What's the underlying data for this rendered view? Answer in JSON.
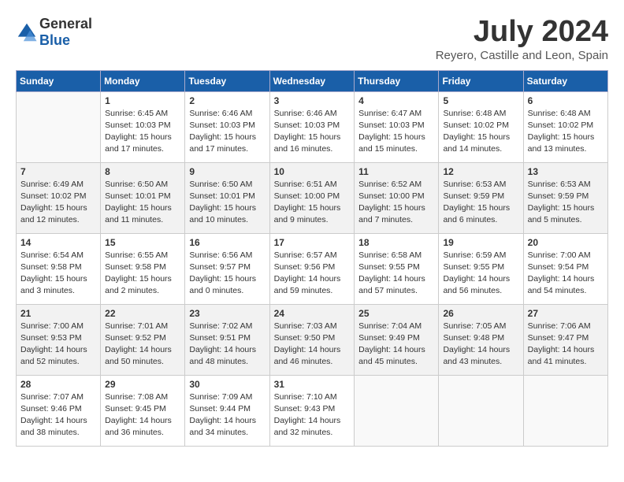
{
  "logo": {
    "general": "General",
    "blue": "Blue"
  },
  "title": {
    "month_year": "July 2024",
    "location": "Reyero, Castille and Leon, Spain"
  },
  "days_of_week": [
    "Sunday",
    "Monday",
    "Tuesday",
    "Wednesday",
    "Thursday",
    "Friday",
    "Saturday"
  ],
  "weeks": [
    [
      {
        "num": "",
        "sunrise": "",
        "sunset": "",
        "daylight": ""
      },
      {
        "num": "1",
        "sunrise": "Sunrise: 6:45 AM",
        "sunset": "Sunset: 10:03 PM",
        "daylight": "Daylight: 15 hours and 17 minutes."
      },
      {
        "num": "2",
        "sunrise": "Sunrise: 6:46 AM",
        "sunset": "Sunset: 10:03 PM",
        "daylight": "Daylight: 15 hours and 17 minutes."
      },
      {
        "num": "3",
        "sunrise": "Sunrise: 6:46 AM",
        "sunset": "Sunset: 10:03 PM",
        "daylight": "Daylight: 15 hours and 16 minutes."
      },
      {
        "num": "4",
        "sunrise": "Sunrise: 6:47 AM",
        "sunset": "Sunset: 10:03 PM",
        "daylight": "Daylight: 15 hours and 15 minutes."
      },
      {
        "num": "5",
        "sunrise": "Sunrise: 6:48 AM",
        "sunset": "Sunset: 10:02 PM",
        "daylight": "Daylight: 15 hours and 14 minutes."
      },
      {
        "num": "6",
        "sunrise": "Sunrise: 6:48 AM",
        "sunset": "Sunset: 10:02 PM",
        "daylight": "Daylight: 15 hours and 13 minutes."
      }
    ],
    [
      {
        "num": "7",
        "sunrise": "Sunrise: 6:49 AM",
        "sunset": "Sunset: 10:02 PM",
        "daylight": "Daylight: 15 hours and 12 minutes."
      },
      {
        "num": "8",
        "sunrise": "Sunrise: 6:50 AM",
        "sunset": "Sunset: 10:01 PM",
        "daylight": "Daylight: 15 hours and 11 minutes."
      },
      {
        "num": "9",
        "sunrise": "Sunrise: 6:50 AM",
        "sunset": "Sunset: 10:01 PM",
        "daylight": "Daylight: 15 hours and 10 minutes."
      },
      {
        "num": "10",
        "sunrise": "Sunrise: 6:51 AM",
        "sunset": "Sunset: 10:00 PM",
        "daylight": "Daylight: 15 hours and 9 minutes."
      },
      {
        "num": "11",
        "sunrise": "Sunrise: 6:52 AM",
        "sunset": "Sunset: 10:00 PM",
        "daylight": "Daylight: 15 hours and 7 minutes."
      },
      {
        "num": "12",
        "sunrise": "Sunrise: 6:53 AM",
        "sunset": "Sunset: 9:59 PM",
        "daylight": "Daylight: 15 hours and 6 minutes."
      },
      {
        "num": "13",
        "sunrise": "Sunrise: 6:53 AM",
        "sunset": "Sunset: 9:59 PM",
        "daylight": "Daylight: 15 hours and 5 minutes."
      }
    ],
    [
      {
        "num": "14",
        "sunrise": "Sunrise: 6:54 AM",
        "sunset": "Sunset: 9:58 PM",
        "daylight": "Daylight: 15 hours and 3 minutes."
      },
      {
        "num": "15",
        "sunrise": "Sunrise: 6:55 AM",
        "sunset": "Sunset: 9:58 PM",
        "daylight": "Daylight: 15 hours and 2 minutes."
      },
      {
        "num": "16",
        "sunrise": "Sunrise: 6:56 AM",
        "sunset": "Sunset: 9:57 PM",
        "daylight": "Daylight: 15 hours and 0 minutes."
      },
      {
        "num": "17",
        "sunrise": "Sunrise: 6:57 AM",
        "sunset": "Sunset: 9:56 PM",
        "daylight": "Daylight: 14 hours and 59 minutes."
      },
      {
        "num": "18",
        "sunrise": "Sunrise: 6:58 AM",
        "sunset": "Sunset: 9:55 PM",
        "daylight": "Daylight: 14 hours and 57 minutes."
      },
      {
        "num": "19",
        "sunrise": "Sunrise: 6:59 AM",
        "sunset": "Sunset: 9:55 PM",
        "daylight": "Daylight: 14 hours and 56 minutes."
      },
      {
        "num": "20",
        "sunrise": "Sunrise: 7:00 AM",
        "sunset": "Sunset: 9:54 PM",
        "daylight": "Daylight: 14 hours and 54 minutes."
      }
    ],
    [
      {
        "num": "21",
        "sunrise": "Sunrise: 7:00 AM",
        "sunset": "Sunset: 9:53 PM",
        "daylight": "Daylight: 14 hours and 52 minutes."
      },
      {
        "num": "22",
        "sunrise": "Sunrise: 7:01 AM",
        "sunset": "Sunset: 9:52 PM",
        "daylight": "Daylight: 14 hours and 50 minutes."
      },
      {
        "num": "23",
        "sunrise": "Sunrise: 7:02 AM",
        "sunset": "Sunset: 9:51 PM",
        "daylight": "Daylight: 14 hours and 48 minutes."
      },
      {
        "num": "24",
        "sunrise": "Sunrise: 7:03 AM",
        "sunset": "Sunset: 9:50 PM",
        "daylight": "Daylight: 14 hours and 46 minutes."
      },
      {
        "num": "25",
        "sunrise": "Sunrise: 7:04 AM",
        "sunset": "Sunset: 9:49 PM",
        "daylight": "Daylight: 14 hours and 45 minutes."
      },
      {
        "num": "26",
        "sunrise": "Sunrise: 7:05 AM",
        "sunset": "Sunset: 9:48 PM",
        "daylight": "Daylight: 14 hours and 43 minutes."
      },
      {
        "num": "27",
        "sunrise": "Sunrise: 7:06 AM",
        "sunset": "Sunset: 9:47 PM",
        "daylight": "Daylight: 14 hours and 41 minutes."
      }
    ],
    [
      {
        "num": "28",
        "sunrise": "Sunrise: 7:07 AM",
        "sunset": "Sunset: 9:46 PM",
        "daylight": "Daylight: 14 hours and 38 minutes."
      },
      {
        "num": "29",
        "sunrise": "Sunrise: 7:08 AM",
        "sunset": "Sunset: 9:45 PM",
        "daylight": "Daylight: 14 hours and 36 minutes."
      },
      {
        "num": "30",
        "sunrise": "Sunrise: 7:09 AM",
        "sunset": "Sunset: 9:44 PM",
        "daylight": "Daylight: 14 hours and 34 minutes."
      },
      {
        "num": "31",
        "sunrise": "Sunrise: 7:10 AM",
        "sunset": "Sunset: 9:43 PM",
        "daylight": "Daylight: 14 hours and 32 minutes."
      },
      {
        "num": "",
        "sunrise": "",
        "sunset": "",
        "daylight": ""
      },
      {
        "num": "",
        "sunrise": "",
        "sunset": "",
        "daylight": ""
      },
      {
        "num": "",
        "sunrise": "",
        "sunset": "",
        "daylight": ""
      }
    ]
  ]
}
